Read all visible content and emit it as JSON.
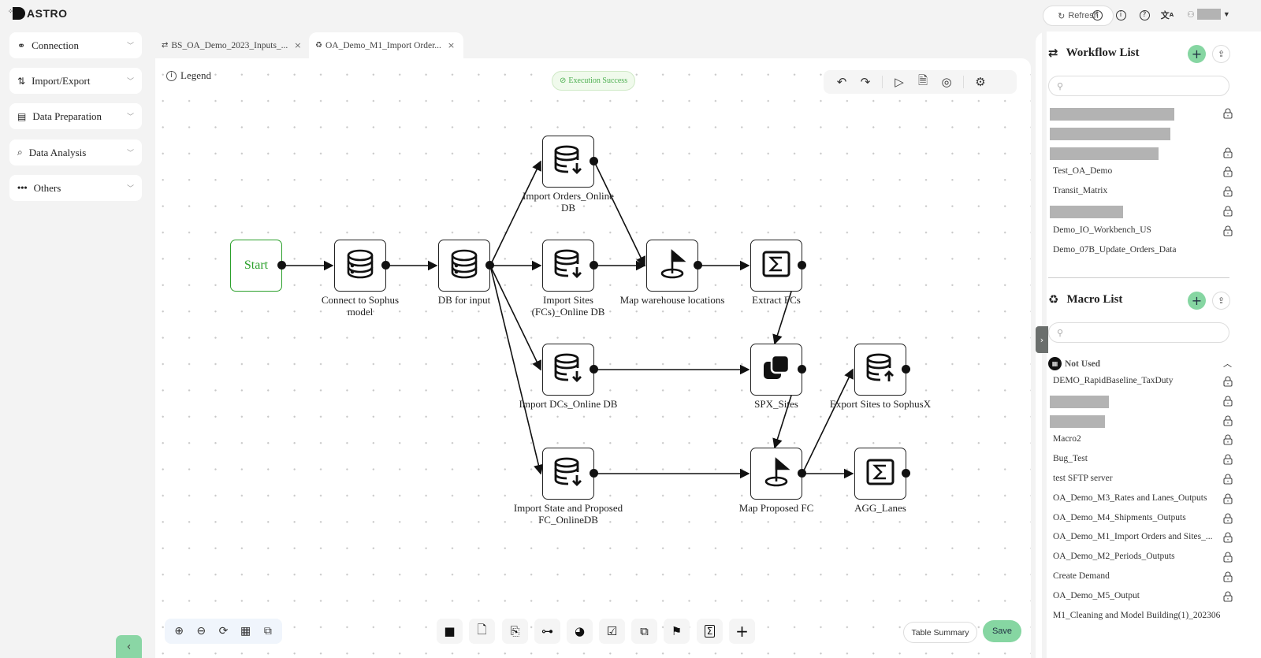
{
  "header": {
    "logo_text": "ASTRO",
    "refresh_label": "Refresh",
    "icons": [
      "upload-circle-icon",
      "info-icon",
      "help-icon",
      "translate-icon",
      "user-icon"
    ]
  },
  "sidebar": {
    "items": [
      {
        "label": "Connection",
        "icon": "connection-icon"
      },
      {
        "label": "Import/Export",
        "icon": "import-export-icon"
      },
      {
        "label": "Data Preparation",
        "icon": "data-preparation-icon"
      },
      {
        "label": "Data Analysis",
        "icon": "data-analysis-icon"
      },
      {
        "label": "Others",
        "icon": "more-icon"
      }
    ]
  },
  "tabs": [
    {
      "label": "BS_OA_Demo_2023_Inputs_...",
      "icon": "workflow-icon",
      "active": false
    },
    {
      "label": "OA_Demo_M1_Import Order...",
      "icon": "macro-icon",
      "active": true
    }
  ],
  "canvas": {
    "legend_label": "Legend",
    "status_badge": "Execution Success",
    "toolbar": [
      "undo",
      "redo",
      "run",
      "log",
      "stop",
      "settings"
    ],
    "nodes": [
      {
        "id": "start",
        "label": "Start",
        "icon": "start"
      },
      {
        "id": "connect",
        "label": "Connect to Sophus model",
        "icon": "database"
      },
      {
        "id": "dbinput",
        "label": "DB for input",
        "icon": "database"
      },
      {
        "id": "orders",
        "label": "Import Orders_Online DB",
        "icon": "db-import"
      },
      {
        "id": "sites",
        "label": "Import Sites (FCs)_Online DB",
        "icon": "db-import"
      },
      {
        "id": "dcs",
        "label": "Import DCs_Online DB",
        "icon": "db-import"
      },
      {
        "id": "state",
        "label": "Import State and Proposed FC_OnlineDB",
        "icon": "db-import"
      },
      {
        "id": "mapwh",
        "label": "Map warehouse locations",
        "icon": "map-flag"
      },
      {
        "id": "extract",
        "label": "Extract FCs",
        "icon": "sigma"
      },
      {
        "id": "spx",
        "label": "SPX_Sites",
        "icon": "merge"
      },
      {
        "id": "mapfc",
        "label": "Map Proposed FC",
        "icon": "map-flag"
      },
      {
        "id": "export",
        "label": "Export Sites to SophusX",
        "icon": "db-export"
      },
      {
        "id": "agg",
        "label": "AGG_Lanes",
        "icon": "sigma"
      }
    ],
    "edges": [
      [
        "start",
        "connect"
      ],
      [
        "connect",
        "dbinput"
      ],
      [
        "dbinput",
        "orders"
      ],
      [
        "dbinput",
        "sites"
      ],
      [
        "dbinput",
        "dcs"
      ],
      [
        "dbinput",
        "state"
      ],
      [
        "orders",
        "mapwh"
      ],
      [
        "sites",
        "mapwh"
      ],
      [
        "mapwh",
        "extract"
      ],
      [
        "extract",
        "spx"
      ],
      [
        "dcs",
        "spx"
      ],
      [
        "spx",
        "mapfc"
      ],
      [
        "state",
        "mapfc"
      ],
      [
        "mapfc",
        "export"
      ],
      [
        "mapfc",
        "agg"
      ]
    ],
    "zoom_tools": [
      "zoom-in",
      "zoom-out",
      "refresh",
      "layout-grid",
      "fit"
    ],
    "node_tools": [
      "note",
      "file-export",
      "file-import",
      "tree",
      "pie-chart",
      "checklist",
      "merge",
      "map-flag",
      "sigma",
      "add"
    ],
    "table_summary_label": "Table Summary",
    "save_label": "Save"
  },
  "workflow_list": {
    "title": "Workflow List",
    "search_placeholder": "",
    "items": [
      {
        "label": "",
        "redacted": true,
        "locked": true
      },
      {
        "label": "",
        "redacted": true,
        "locked": false
      },
      {
        "label": "",
        "redacted": true,
        "locked": true
      },
      {
        "label": "Test_OA_Demo",
        "locked": true
      },
      {
        "label": "Transit_Matrix",
        "locked": true
      },
      {
        "label": "",
        "redacted": true,
        "locked": true
      },
      {
        "label": "Demo_IO_Workbench_US",
        "locked": true
      },
      {
        "label": "Demo_07B_Update_Orders_Data",
        "locked": false
      }
    ]
  },
  "macro_list": {
    "title": "Macro List",
    "search_placeholder": "",
    "group_label": "Not Used",
    "items": [
      {
        "label": "DEMO_RapidBaseline_TaxDuty",
        "locked": true
      },
      {
        "label": "",
        "redacted": true,
        "locked": true
      },
      {
        "label": "",
        "redacted": true,
        "locked": true
      },
      {
        "label": "Macro2",
        "locked": true
      },
      {
        "label": "Bug_Test",
        "locked": true
      },
      {
        "label": "test SFTP server",
        "locked": true
      },
      {
        "label": "OA_Demo_M3_Rates and Lanes_Outputs",
        "locked": true
      },
      {
        "label": "OA_Demo_M4_Shipments_Outputs",
        "locked": true
      },
      {
        "label": "OA_Demo_M1_Import Orders and Sites_...",
        "locked": true
      },
      {
        "label": "OA_Demo_M2_Periods_Outputs",
        "locked": true
      },
      {
        "label": "Create Demand",
        "locked": true
      },
      {
        "label": "OA_Demo_M5_Output",
        "locked": true
      },
      {
        "label": "M1_Cleaning and Model Building(1)_202306",
        "locked": false
      }
    ]
  }
}
